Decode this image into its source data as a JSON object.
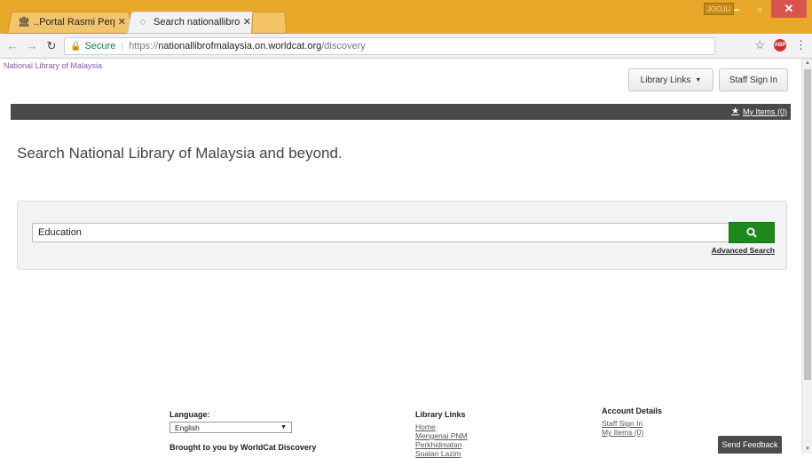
{
  "browser": {
    "tabs": [
      {
        "title": "..Portal Rasmi Perpustak",
        "favicon": "library-icon"
      },
      {
        "title": "Search nationallibrofmal",
        "favicon": "loading-icon"
      }
    ],
    "user_badge": "JOOJU",
    "secure_label": "Secure",
    "url_scheme": "https://",
    "url_host": "nationallibrofmalaysia.on.worldcat.org",
    "url_path": "/discovery"
  },
  "header": {
    "library_name": "National Library of Malaysia",
    "library_links_label": "Library Links",
    "staff_sign_in_label": "Staff Sign In",
    "my_items_label": "My Items (0)"
  },
  "main": {
    "headline": "Search National Library of Malaysia and beyond.",
    "search_value": "Education",
    "advanced_search_label": "Advanced Search"
  },
  "footer": {
    "language_label": "Language:",
    "language_value": "English",
    "brought_label": "Brought to you by WorldCat Discovery",
    "library_links": {
      "heading": "Library Links",
      "items": [
        "Home",
        "Mengenai PNM",
        "Perkhidmatan",
        "Soalan Lazim"
      ]
    },
    "account": {
      "heading": "Account Details",
      "items": [
        "Staff Sign In",
        "My Items (0)"
      ]
    },
    "feedback_label": "Send Feedback"
  },
  "colors": {
    "accent": "#1e8a1e",
    "chrome": "#e8a92a",
    "bar": "#4a4a4a"
  }
}
